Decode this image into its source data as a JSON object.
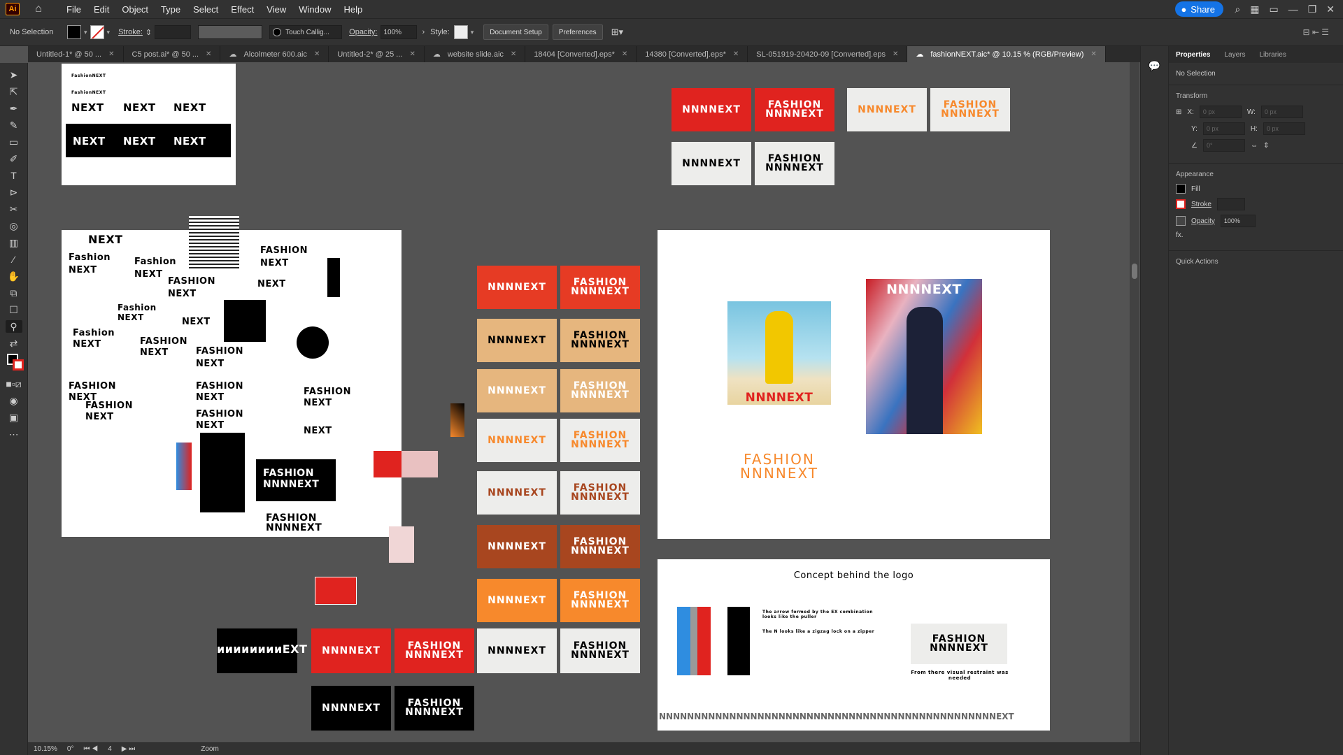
{
  "app": {
    "logo": "Ai",
    "menus": [
      "File",
      "Edit",
      "Object",
      "Type",
      "Select",
      "Effect",
      "View",
      "Window",
      "Help"
    ],
    "share_label": "Share"
  },
  "control": {
    "selection": "No Selection",
    "stroke_label": "Stroke:",
    "brush": "Touch Callig...",
    "opacity_label": "Opacity:",
    "opacity_value": "100%",
    "style_label": "Style:",
    "document_setup": "Document Setup",
    "preferences": "Preferences"
  },
  "tabs": [
    {
      "label": "Untitled-1* @ 50 ..."
    },
    {
      "label": "C5 post.ai* @ 50 ..."
    },
    {
      "label": "Alcolmeter 600.aic"
    },
    {
      "label": "Untitled-2* @ 25 ..."
    },
    {
      "label": "website slide.aic"
    },
    {
      "label": "18404 [Converted].eps*"
    },
    {
      "label": "14380 [Converted].eps*"
    },
    {
      "label": "SL-051919-20420-09 [Converted].eps"
    },
    {
      "label": "fashionNEXT.aic* @ 10.15 % (RGB/Preview)"
    }
  ],
  "panel": {
    "tabs": [
      "Properties",
      "Layers",
      "Libraries"
    ],
    "no_selection": "No Selection",
    "transform": "Transform",
    "x_label": "X:",
    "y_label": "Y:",
    "w_label": "W:",
    "h_label": "H:",
    "x_val": "0 px",
    "y_val": "0 px",
    "w_val": "0 px",
    "h_val": "0 px",
    "angle_val": "0°",
    "appearance": "Appearance",
    "fill": "Fill",
    "stroke": "Stroke",
    "opacity": "Opacity",
    "opacity_value": "100%",
    "fx": "fx.",
    "quick_actions": "Quick Actions"
  },
  "status": {
    "zoom": "10.15%",
    "rotation": "0°",
    "artboard": "4",
    "tool": "Zoom"
  },
  "art": {
    "nnnext": "NNNNEXT",
    "fashion": "FASHION",
    "next": "NEXT",
    "fashion_title": "Fashion",
    "fashion_next_small": "FashionNEXT",
    "zip_word": "ииииииииEXT",
    "concept_title": "Concept behind the logo",
    "concept_note1": "The arrow formed by the EX combination looks like the puller",
    "concept_note2": "The N looks like a zigzag lock on a zipper",
    "concept_caption": "From there visual restraint was needed",
    "concept_strip": "NNNNNNNNNNNNNNNNNNNNNNNNNNNNNNNNNNNNNNNNNNNNNNNNEXT"
  },
  "colors": {
    "red": "#e0231f",
    "black": "#000000",
    "offwhite": "#ededeb",
    "orange": "#f7892c",
    "tan": "#e6b67e",
    "brown": "#a8461f",
    "accent": "#1473e6"
  }
}
